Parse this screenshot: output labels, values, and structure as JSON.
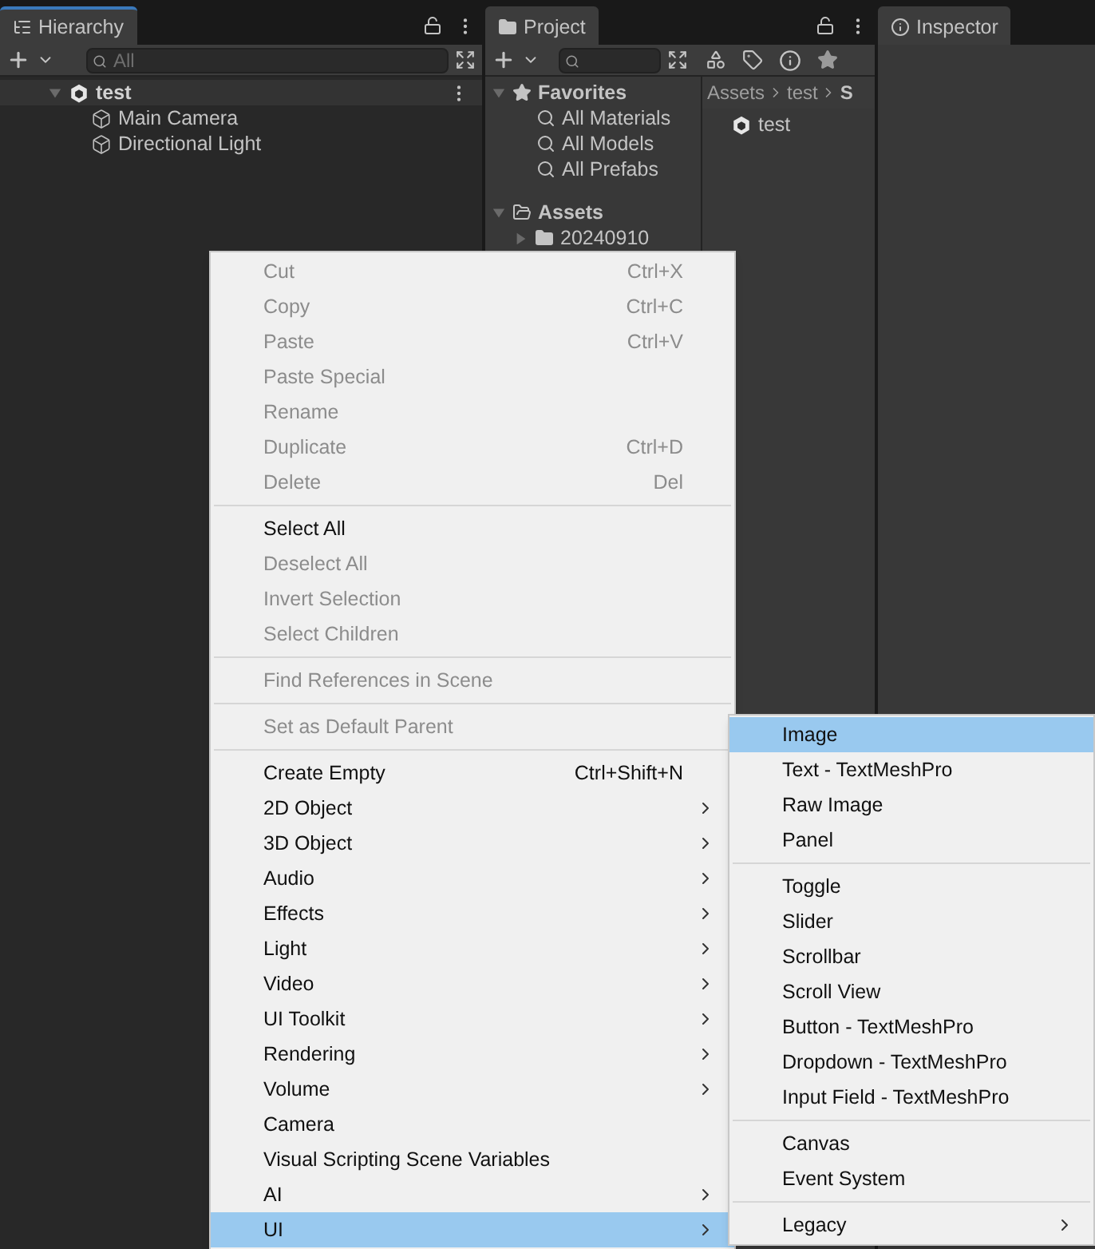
{
  "hierarchy": {
    "tab": {
      "label": "Hierarchy",
      "focused": true
    },
    "search": {
      "placeholder": "All"
    },
    "tree": [
      {
        "label": "test",
        "kind": "scene",
        "expanded": true,
        "children": [
          {
            "label": "Main Camera",
            "kind": "object"
          },
          {
            "label": "Directional Light",
            "kind": "object"
          }
        ]
      }
    ]
  },
  "project": {
    "tab": {
      "label": "Project",
      "focused": false
    },
    "favorites": {
      "label": "Favorites",
      "expanded": true,
      "items": [
        "All Materials",
        "All Models",
        "All Prefabs"
      ]
    },
    "assets": {
      "label": "Assets",
      "expanded": true,
      "children": [
        {
          "label": "20240910",
          "expanded": false
        }
      ]
    },
    "breadcrumb": [
      "Assets",
      "test",
      "S"
    ],
    "files": [
      {
        "label": "test"
      }
    ]
  },
  "inspector": {
    "tab": {
      "label": "Inspector",
      "focused": false
    }
  },
  "menu": {
    "items": [
      {
        "kind": "item",
        "label": "Cut",
        "shortcut": "Ctrl+X",
        "disabled": true,
        "selected": false,
        "submenu": false
      },
      {
        "kind": "item",
        "label": "Copy",
        "shortcut": "Ctrl+C",
        "disabled": true,
        "selected": false,
        "submenu": false
      },
      {
        "kind": "item",
        "label": "Paste",
        "shortcut": "Ctrl+V",
        "disabled": true,
        "selected": false,
        "submenu": false
      },
      {
        "kind": "item",
        "label": "Paste Special",
        "disabled": true,
        "selected": false,
        "submenu": false
      },
      {
        "kind": "item",
        "label": "Rename",
        "disabled": true,
        "selected": false,
        "submenu": false
      },
      {
        "kind": "item",
        "label": "Duplicate",
        "shortcut": "Ctrl+D",
        "disabled": true,
        "selected": false,
        "submenu": false
      },
      {
        "kind": "item",
        "label": "Delete",
        "shortcut": "Del",
        "disabled": true,
        "selected": false,
        "submenu": false
      },
      {
        "kind": "separator"
      },
      {
        "kind": "item",
        "label": "Select All",
        "disabled": false,
        "selected": false,
        "submenu": false
      },
      {
        "kind": "item",
        "label": "Deselect All",
        "disabled": true,
        "selected": false,
        "submenu": false
      },
      {
        "kind": "item",
        "label": "Invert Selection",
        "disabled": true,
        "selected": false,
        "submenu": false
      },
      {
        "kind": "item",
        "label": "Select Children",
        "disabled": true,
        "selected": false,
        "submenu": false
      },
      {
        "kind": "separator"
      },
      {
        "kind": "item",
        "label": "Find References in Scene",
        "disabled": true,
        "selected": false,
        "submenu": false
      },
      {
        "kind": "separator"
      },
      {
        "kind": "item",
        "label": "Set as Default Parent",
        "disabled": true,
        "selected": false,
        "submenu": false
      },
      {
        "kind": "separator"
      },
      {
        "kind": "item",
        "label": "Create Empty",
        "shortcut": "Ctrl+Shift+N",
        "disabled": false,
        "selected": false,
        "submenu": false
      },
      {
        "kind": "item",
        "label": "2D Object",
        "disabled": false,
        "selected": false,
        "submenu": true
      },
      {
        "kind": "item",
        "label": "3D Object",
        "disabled": false,
        "selected": false,
        "submenu": true
      },
      {
        "kind": "item",
        "label": "Audio",
        "disabled": false,
        "selected": false,
        "submenu": true
      },
      {
        "kind": "item",
        "label": "Effects",
        "disabled": false,
        "selected": false,
        "submenu": true
      },
      {
        "kind": "item",
        "label": "Light",
        "disabled": false,
        "selected": false,
        "submenu": true
      },
      {
        "kind": "item",
        "label": "Video",
        "disabled": false,
        "selected": false,
        "submenu": true
      },
      {
        "kind": "item",
        "label": "UI Toolkit",
        "disabled": false,
        "selected": false,
        "submenu": true
      },
      {
        "kind": "item",
        "label": "Rendering",
        "disabled": false,
        "selected": false,
        "submenu": true
      },
      {
        "kind": "item",
        "label": "Volume",
        "disabled": false,
        "selected": false,
        "submenu": true
      },
      {
        "kind": "item",
        "label": "Camera",
        "disabled": false,
        "selected": false,
        "submenu": false
      },
      {
        "kind": "item",
        "label": "Visual Scripting Scene Variables",
        "disabled": false,
        "selected": false,
        "submenu": false
      },
      {
        "kind": "item",
        "label": "AI",
        "disabled": false,
        "selected": false,
        "submenu": true
      },
      {
        "kind": "item",
        "label": "UI",
        "disabled": false,
        "selected": true,
        "submenu": true
      }
    ]
  },
  "submenu": {
    "items": [
      {
        "kind": "item",
        "label": "Image",
        "disabled": false,
        "selected": true,
        "submenu": false
      },
      {
        "kind": "item",
        "label": "Text - TextMeshPro",
        "disabled": false,
        "selected": false,
        "submenu": false
      },
      {
        "kind": "item",
        "label": "Raw Image",
        "disabled": false,
        "selected": false,
        "submenu": false
      },
      {
        "kind": "item",
        "label": "Panel",
        "disabled": false,
        "selected": false,
        "submenu": false
      },
      {
        "kind": "separator"
      },
      {
        "kind": "item",
        "label": "Toggle",
        "disabled": false,
        "selected": false,
        "submenu": false
      },
      {
        "kind": "item",
        "label": "Slider",
        "disabled": false,
        "selected": false,
        "submenu": false
      },
      {
        "kind": "item",
        "label": "Scrollbar",
        "disabled": false,
        "selected": false,
        "submenu": false
      },
      {
        "kind": "item",
        "label": "Scroll View",
        "disabled": false,
        "selected": false,
        "submenu": false
      },
      {
        "kind": "item",
        "label": "Button - TextMeshPro",
        "disabled": false,
        "selected": false,
        "submenu": false
      },
      {
        "kind": "item",
        "label": "Dropdown - TextMeshPro",
        "disabled": false,
        "selected": false,
        "submenu": false
      },
      {
        "kind": "item",
        "label": "Input Field - TextMeshPro",
        "disabled": false,
        "selected": false,
        "submenu": false
      },
      {
        "kind": "separator"
      },
      {
        "kind": "item",
        "label": "Canvas",
        "disabled": false,
        "selected": false,
        "submenu": false
      },
      {
        "kind": "item",
        "label": "Event System",
        "disabled": false,
        "selected": false,
        "submenu": false
      },
      {
        "kind": "separator"
      },
      {
        "kind": "item",
        "label": "Legacy",
        "disabled": false,
        "selected": false,
        "submenu": true
      }
    ]
  }
}
